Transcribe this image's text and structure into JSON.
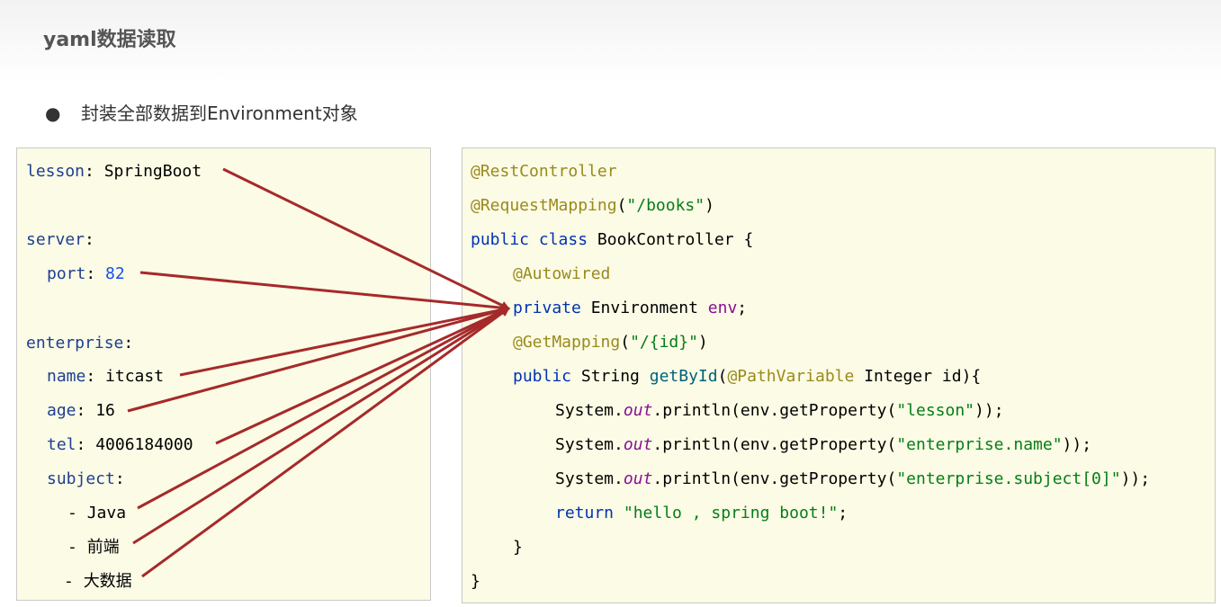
{
  "slide": {
    "title": "yaml数据读取",
    "bullet": "封装全部数据到Environment对象"
  },
  "yaml": {
    "lesson_key": "lesson",
    "lesson_value": "SpringBoot",
    "server_key": "server",
    "port_key": "port",
    "port_value": "82",
    "enterprise_key": "enterprise",
    "name_key": "name",
    "name_value": "itcast",
    "age_key": "age",
    "age_value": "16",
    "tel_key": "tel",
    "tel_value": "4006184000",
    "subject_key": "subject",
    "subjects": [
      "Java",
      "前端",
      "大数据"
    ]
  },
  "java": {
    "ann_rest": "@RestController",
    "ann_mapping": "@RequestMapping",
    "mapping_arg": "\"/books\"",
    "kw_public": "public",
    "kw_class": "class",
    "class_name": "BookController",
    "ann_autowired": "@Autowired",
    "kw_private": "private",
    "type_env": "Environment",
    "field_env": "env",
    "ann_getmapping": "@GetMapping",
    "getmapping_arg": "\"/{id}\"",
    "type_string": "String",
    "method_name": "getById",
    "ann_pathvar": "@PathVariable",
    "param_type": "Integer",
    "param_name": "id",
    "sys": "System.",
    "out": "out",
    "println": ".println(",
    "getprop": "env.getProperty(",
    "prop_lesson": "\"lesson\"",
    "prop_name": "\"enterprise.name\"",
    "prop_subject": "\"enterprise.subject[0]\"",
    "kw_return": "return",
    "return_value": "\"hello , spring boot!\""
  },
  "colors": {
    "box_bg": "#fbfbe6",
    "arrow": "#a52a2a",
    "annotation": "#9a8a1c",
    "keyword": "#0033b3",
    "string": "#067d17"
  }
}
